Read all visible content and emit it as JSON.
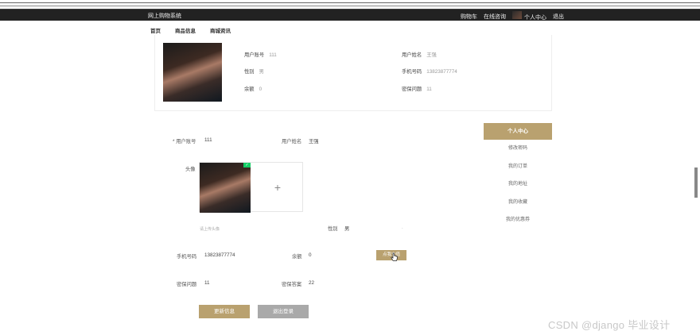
{
  "topbar": {
    "site_title": "网上购物系统",
    "cart": "购物车",
    "online_consult": "在线咨询",
    "user_center": "个人中心",
    "logout": "退出"
  },
  "nav": [
    "首页",
    "商品信息",
    "商城资讯"
  ],
  "profile": {
    "username_label": "用户账号",
    "username": "111",
    "name_label": "用户姓名",
    "name": "王强",
    "gender_label": "性别",
    "gender": "男",
    "phone_label": "手机号码",
    "phone": "13823877774",
    "balance_label": "余额",
    "balance": "0",
    "security_q_label": "密保问题",
    "security_q": "11"
  },
  "form": {
    "username_label": "* 用户账号",
    "username": "111",
    "name_label": "用户姓名",
    "name": "王强",
    "avatar_label": "头像",
    "upload_plus": "+",
    "upload_hint": "请上传头像",
    "gender_label": "性别",
    "gender": "男",
    "phone_label": "手机号码",
    "phone": "13823877774",
    "balance_label": "余额",
    "balance": "0",
    "recharge_button": "点我充值",
    "security_q_label": "密保问题",
    "security_q": "11",
    "security_a_label": "密保答案",
    "security_a": "22",
    "update_button": "更新信息",
    "logout_button": "退出登录"
  },
  "sidemenu": {
    "header": "个人中心",
    "items": [
      "修改密码",
      "我的订单",
      "我的地址",
      "我的收藏",
      "我的优惠券"
    ]
  },
  "watermark": "CSDN @django 毕业设计",
  "colors": {
    "accent": "#b9a16f",
    "topbar_bg": "#222222",
    "secondary_button": "#a9a9a9",
    "upload_check": "#13ce66"
  }
}
